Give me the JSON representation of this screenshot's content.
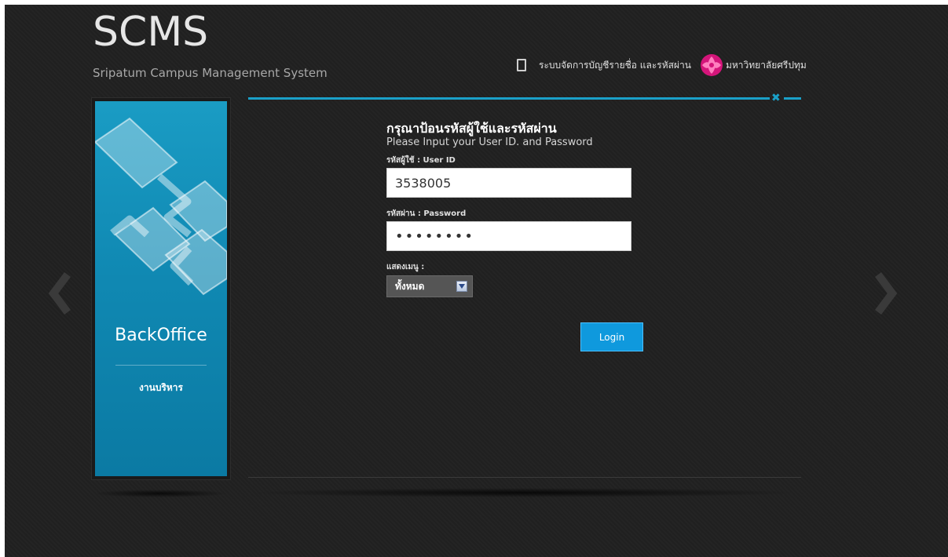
{
  "brand": {
    "title": "SCMS",
    "subtitle": "Sripatum Campus Management System"
  },
  "topbar": {
    "device_icon": "tablet-icon",
    "account_text": "ระบบจัดการบัญชีรายชื่อ และรหัสผ่าน",
    "logo_icon": "university-logo-icon",
    "university_name": "มหาวิทยาลัยศรีปทุม",
    "logo_color": "#d4157a"
  },
  "side_panel": {
    "title": "BackOffice",
    "subtitle": "งานบริหาร",
    "accent_color": "#1a9cc4"
  },
  "form": {
    "heading": "กรุณาป้อนรหัสผู้ใช้และรหัสผ่าน",
    "subheading": "Please Input your User ID. and Password",
    "user_label": "รหัสผู้ใช้ : User ID",
    "user_value": "3538005",
    "password_label": "รหัสผ่าน : Password",
    "password_value": "••••••••",
    "menu_label": "แสดงเมนู :",
    "menu_selected": "ทั้งหมด",
    "login_label": "Login",
    "accent_color": "#0f99dd"
  },
  "nav": {
    "prev_icon": "chevron-left-icon",
    "next_icon": "chevron-right-icon",
    "close_icon": "close-icon"
  }
}
